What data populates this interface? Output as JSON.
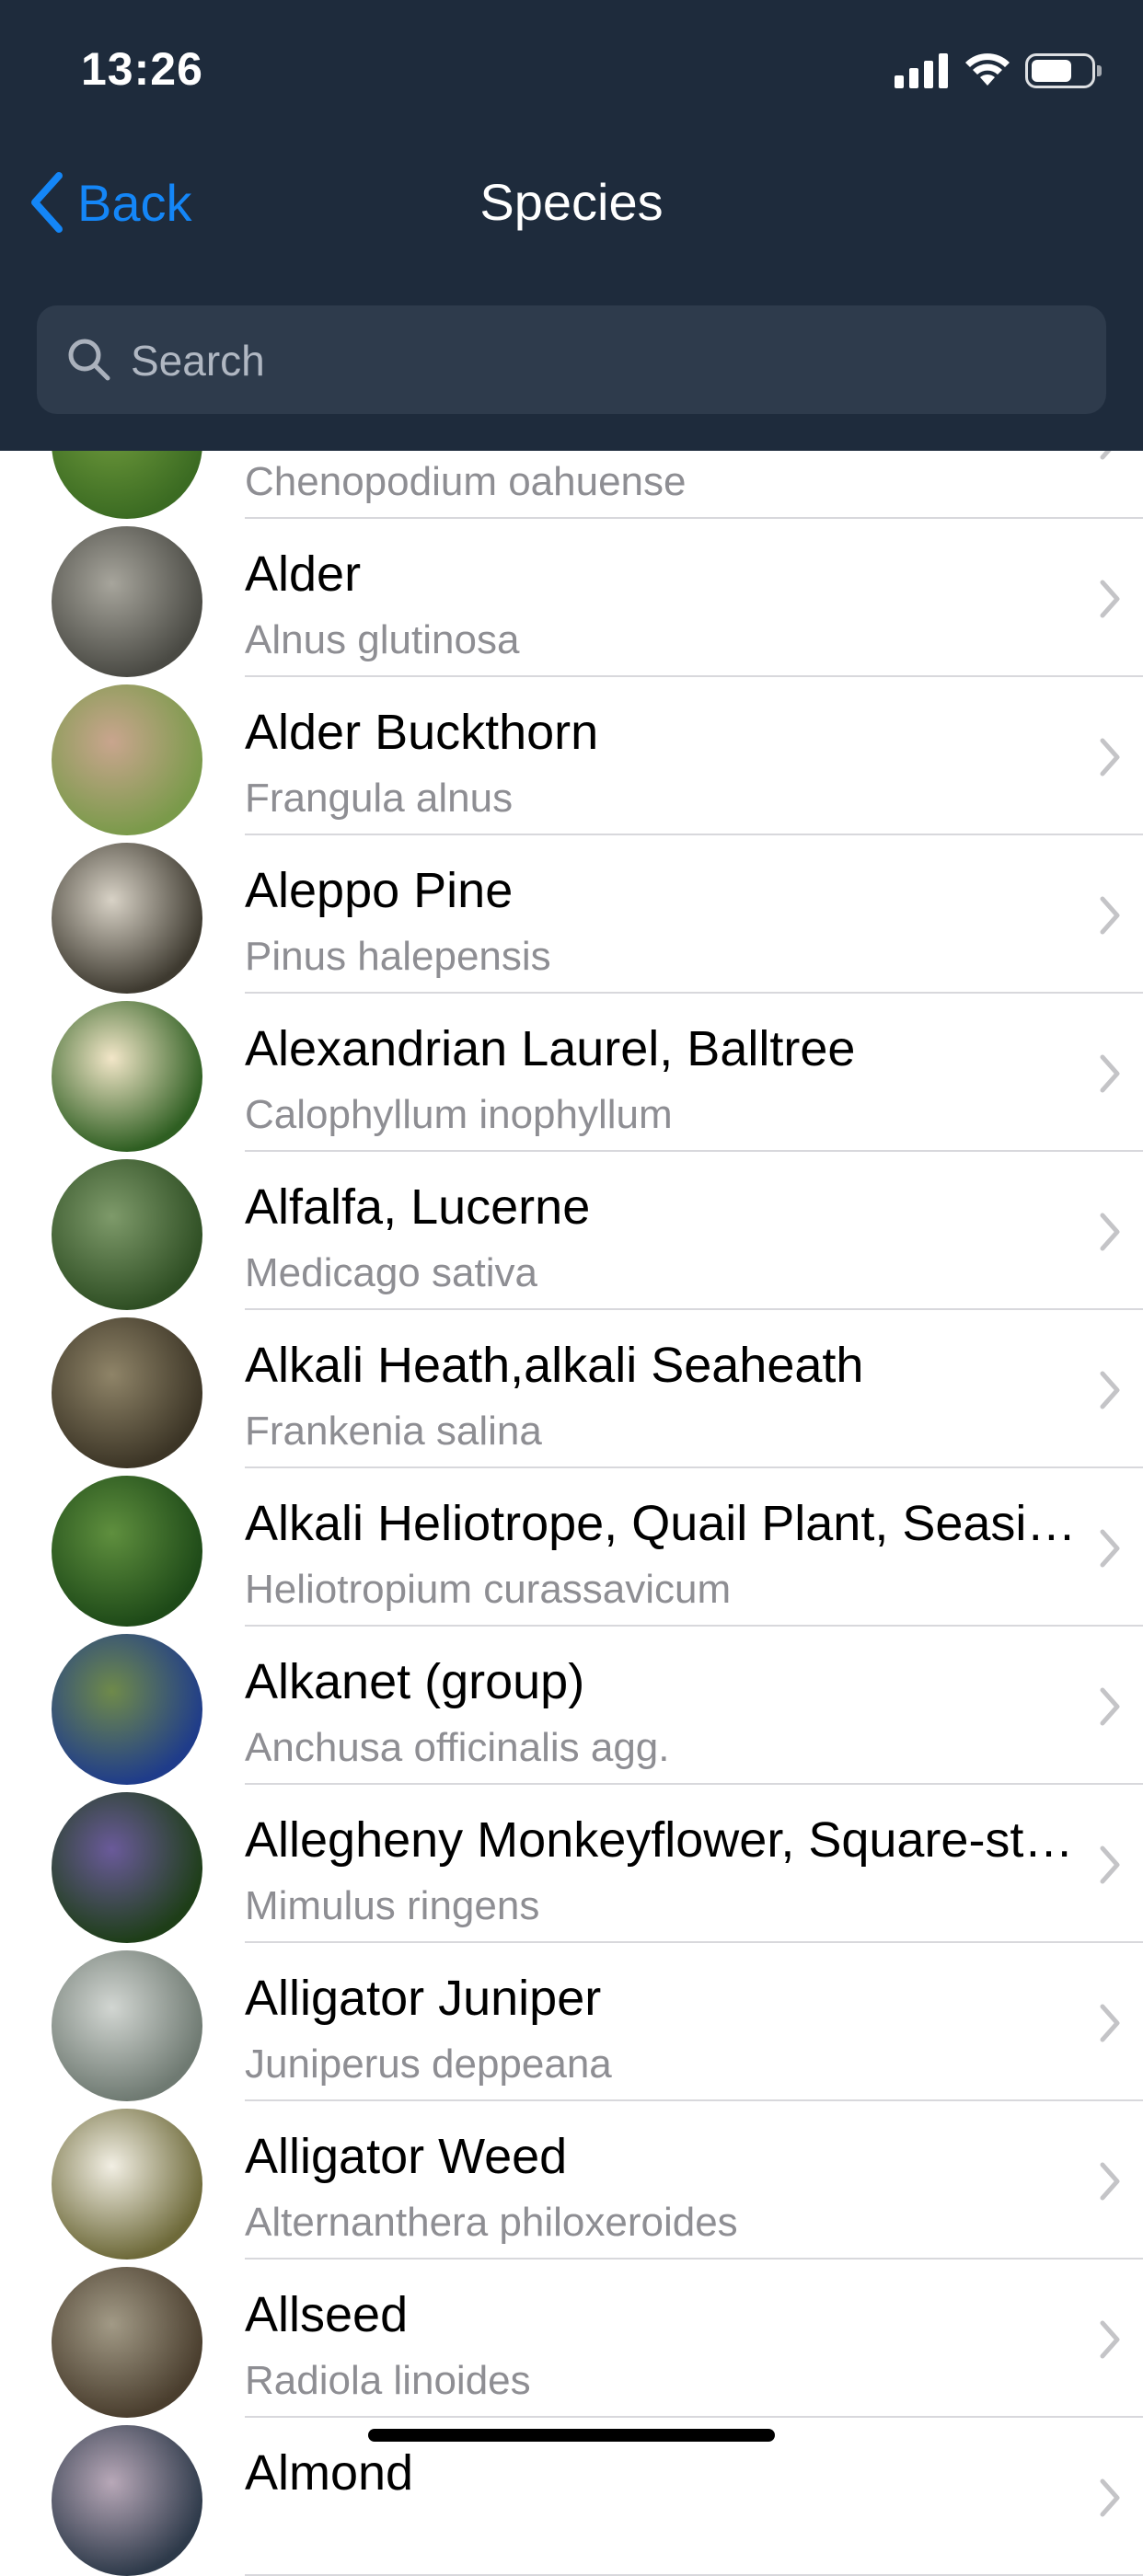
{
  "status_bar": {
    "time": "13:26",
    "battery_level": 0.7
  },
  "nav": {
    "back_label": "Back",
    "title": "Species"
  },
  "search": {
    "placeholder": "Search"
  },
  "species": [
    {
      "name": "",
      "scientific": "Chenopodium oahuense",
      "colors": [
        "#3b6b22",
        "#6f9a3c"
      ]
    },
    {
      "name": "Alder",
      "scientific": "Alnus glutinosa",
      "colors": [
        "#4a4a44",
        "#a7a59c"
      ]
    },
    {
      "name": "Alder Buckthorn",
      "scientific": "Frangula alnus",
      "colors": [
        "#7a9a4a",
        "#c9a58e"
      ]
    },
    {
      "name": "Aleppo Pine",
      "scientific": "Pinus halepensis",
      "colors": [
        "#3e3a30",
        "#d8d2c6"
      ]
    },
    {
      "name": "Alexandrian Laurel, Balltree",
      "scientific": "Calophyllum inophyllum",
      "colors": [
        "#2f5f22",
        "#f2e6c8"
      ]
    },
    {
      "name": "Alfalfa, Lucerne",
      "scientific": "Medicago sativa",
      "colors": [
        "#2f4f24",
        "#7e9a6a"
      ]
    },
    {
      "name": "Alkali Heath,alkali Seaheath",
      "scientific": "Frankenia salina",
      "colors": [
        "#3c3526",
        "#8f8468"
      ]
    },
    {
      "name": "Alkali Heliotrope, Quail Plant, Seaside Heliotrope",
      "scientific": "Heliotropium curassavicum",
      "colors": [
        "#1e4a18",
        "#5f8f3e"
      ]
    },
    {
      "name": "Alkanet (group)",
      "scientific": "Anchusa officinalis agg.",
      "colors": [
        "#1f3c8a",
        "#6f8a4a"
      ]
    },
    {
      "name": "Allegheny Monkeyflower, Square-stemmed Monkeyflower",
      "scientific": "Mimulus ringens",
      "colors": [
        "#1e3e18",
        "#6a5a9a"
      ]
    },
    {
      "name": "Alligator Juniper",
      "scientific": "Juniperus deppeana",
      "colors": [
        "#6f7a72",
        "#d2d6d2"
      ]
    },
    {
      "name": "Alligator Weed",
      "scientific": "Alternanthera philoxeroides",
      "colors": [
        "#6e6a3a",
        "#f2efe4"
      ]
    },
    {
      "name": "Allseed",
      "scientific": "Radiola linoides",
      "colors": [
        "#4a3e2e",
        "#a29a86"
      ]
    },
    {
      "name": "Almond",
      "scientific": "",
      "colors": [
        "#2e3a4a",
        "#b8a8b8"
      ]
    }
  ]
}
